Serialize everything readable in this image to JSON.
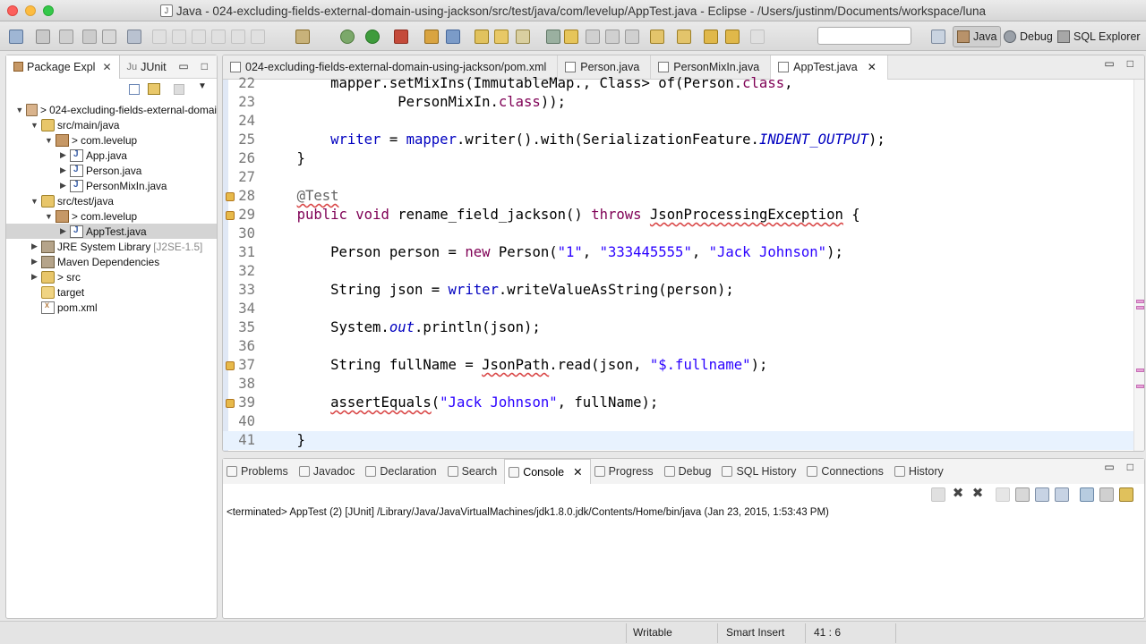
{
  "window": {
    "title": "Java - 024-excluding-fields-external-domain-using-jackson/src/test/java/com/levelup/AppTest.java - Eclipse - /Users/justinm/Documents/workspace/luna"
  },
  "toolbar": {
    "perspectives": [
      {
        "label": "Java",
        "icon": "java-perspective-icon",
        "active": true
      },
      {
        "label": "Debug",
        "icon": "bug-icon"
      },
      {
        "label": "SQL Explorer",
        "icon": "database-icon"
      }
    ]
  },
  "explorer": {
    "tabs": [
      {
        "label": "Package Expl",
        "active": true
      },
      {
        "label": "JUnit"
      }
    ],
    "close": "✕",
    "tree": [
      {
        "label": "> 024-excluding-fields-external-domai",
        "icon": "project",
        "depth": 0,
        "twisty": "open"
      },
      {
        "label": "src/main/java",
        "icon": "srcfolder",
        "depth": 1,
        "twisty": "open"
      },
      {
        "label": "> com.levelup",
        "icon": "package",
        "depth": 2,
        "twisty": "open"
      },
      {
        "label": "App.java",
        "icon": "java",
        "depth": 3,
        "twisty": "closed"
      },
      {
        "label": "Person.java",
        "icon": "java",
        "depth": 3,
        "twisty": "closed"
      },
      {
        "label": "PersonMixIn.java",
        "icon": "java",
        "depth": 3,
        "twisty": "closed"
      },
      {
        "label": "src/test/java",
        "icon": "srcfolder",
        "depth": 1,
        "twisty": "open"
      },
      {
        "label": "> com.levelup",
        "icon": "package",
        "depth": 2,
        "twisty": "open"
      },
      {
        "label": "AppTest.java",
        "icon": "java",
        "depth": 3,
        "twisty": "closed",
        "selected": true
      },
      {
        "label": "JRE System Library",
        "suffix": "[J2SE-1.5]",
        "icon": "lib",
        "depth": 1,
        "twisty": "closed"
      },
      {
        "label": "Maven Dependencies",
        "icon": "lib",
        "depth": 1,
        "twisty": "closed"
      },
      {
        "label": "> src",
        "icon": "srcfolder",
        "depth": 1,
        "twisty": "closed"
      },
      {
        "label": "target",
        "icon": "folder",
        "depth": 1,
        "twisty": ""
      },
      {
        "label": "pom.xml",
        "icon": "xml",
        "depth": 1,
        "twisty": ""
      }
    ]
  },
  "editor": {
    "tabs": [
      {
        "label": "024-excluding-fields-external-domain-using-jackson/pom.xml"
      },
      {
        "label": "Person.java"
      },
      {
        "label": "PersonMixIn.java"
      },
      {
        "label": "AppTest.java",
        "active": true
      }
    ],
    "close": "✕",
    "lines": [
      {
        "num": "22",
        "html": "        mapper.setMixIns(ImmutableMap.<Class<?>, Class<?>> of(Person.<span class=\"kw\">class</span>,"
      },
      {
        "num": "23",
        "html": "                PersonMixIn.<span class=\"kw\">class</span>));"
      },
      {
        "num": "24",
        "html": ""
      },
      {
        "num": "25",
        "html": "        <span class=\"fld\">writer</span> = <span class=\"fld\">mapper</span>.writer().with(SerializationFeature.<span class=\"ital\">INDENT_OUTPUT</span>);"
      },
      {
        "num": "26",
        "html": "    }"
      },
      {
        "num": "27",
        "html": ""
      },
      {
        "num": "28",
        "html": "    <span class=\"ann err\">@Test</span>"
      },
      {
        "num": "29",
        "html": "    <span class=\"kw\">public</span> <span class=\"kw\">void</span> rename_field_jackson() <span class=\"kw\">throws</span> <span class=\"err\">JsonProcessingException</span> {"
      },
      {
        "num": "30",
        "html": ""
      },
      {
        "num": "31",
        "html": "        Person person = <span class=\"kw\">new</span> Person(<span class=\"str\">\"1\"</span>, <span class=\"str\">\"333445555\"</span>, <span class=\"str\">\"Jack Johnson\"</span>);"
      },
      {
        "num": "32",
        "html": ""
      },
      {
        "num": "33",
        "html": "        String json = <span class=\"fld\">writer</span>.writeValueAsString(person);"
      },
      {
        "num": "34",
        "html": ""
      },
      {
        "num": "35",
        "html": "        System.<span class=\"ital\">out</span>.println(json);"
      },
      {
        "num": "36",
        "html": ""
      },
      {
        "num": "37",
        "html": "        String fullName = <span class=\"err\">JsonPath</span>.read(json, <span class=\"str\">\"$.fullname\"</span>);"
      },
      {
        "num": "38",
        "html": ""
      },
      {
        "num": "39",
        "html": "        <span class=\"err\">assertEquals</span>(<span class=\"str\">\"Jack Johnson\"</span>, fullName);"
      },
      {
        "num": "40",
        "html": ""
      },
      {
        "num": "41",
        "html": "    }"
      }
    ],
    "marker_lines": [
      "28",
      "29",
      "37",
      "39"
    ]
  },
  "bottom": {
    "tabs": [
      {
        "label": "Problems",
        "icon": "problems-icon"
      },
      {
        "label": "Javadoc",
        "icon": "at-icon"
      },
      {
        "label": "Declaration",
        "icon": "declaration-icon"
      },
      {
        "label": "Search",
        "icon": "search-icon"
      },
      {
        "label": "Console",
        "icon": "console-icon",
        "active": true
      },
      {
        "label": "Progress",
        "icon": "progress-icon"
      },
      {
        "label": "Debug",
        "icon": "bug-icon"
      },
      {
        "label": "SQL History",
        "icon": "history-icon"
      },
      {
        "label": "Connections",
        "icon": "connections-icon"
      },
      {
        "label": "History",
        "icon": "history-icon"
      }
    ],
    "close": "✕",
    "console_text": "<terminated> AppTest (2) [JUnit] /Library/Java/JavaVirtualMachines/jdk1.8.0.jdk/Contents/Home/bin/java (Jan 23, 2015, 1:53:43 PM)"
  },
  "status": {
    "writable": "Writable",
    "insert_mode": "Smart Insert",
    "position": "41 : 6"
  }
}
